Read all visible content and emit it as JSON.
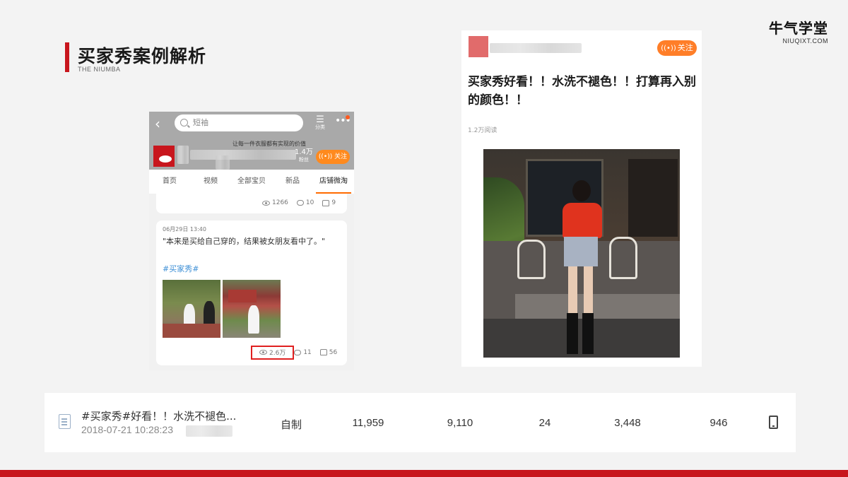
{
  "slide": {
    "title": "买家秀案例解析",
    "subtitle": "THE NIUMBA",
    "brand_cn": "牛气学堂",
    "brand_en": "NIUQIXT.COM"
  },
  "phone": {
    "search_placeholder": "短袖",
    "category_label": "分类",
    "shop_slogan": "让每一件衣服都有实现的价值",
    "fans_count": "1.4万",
    "fans_label": "粉丝",
    "follow_label": "关注",
    "tabs": [
      "首页",
      "视频",
      "全部宝贝",
      "新品",
      "店铺微淘"
    ],
    "active_tab": "店铺微淘",
    "prev_post_stats": {
      "views": "1266",
      "comments": "10",
      "likes": "9"
    },
    "post": {
      "date": "06月29日 13:40",
      "text": "\"本来是买给自己穿的，结果被女朋友看中了。\"",
      "tag": "#买家秀#",
      "views": "2.6万",
      "comments": "11",
      "likes": "56"
    }
  },
  "article": {
    "follow_label": "关注",
    "title": "买家秀好看！！水洗不褪色！！打算再入别的颜色！！",
    "reads": "1.2万阅读"
  },
  "table_row": {
    "title": "#买家秀#好看！！水洗不褪色...",
    "time": "2018-07-21 10:28:23",
    "type": "自制",
    "values": [
      "11,959",
      "9,110",
      "24",
      "3,448",
      "946"
    ],
    "device_icon": "phone-icon"
  },
  "colors": {
    "accent_red": "#c8161d",
    "follow_orange": "#ff7e28",
    "tag_blue": "#3d8fd6",
    "highlight_red": "#e02020"
  }
}
